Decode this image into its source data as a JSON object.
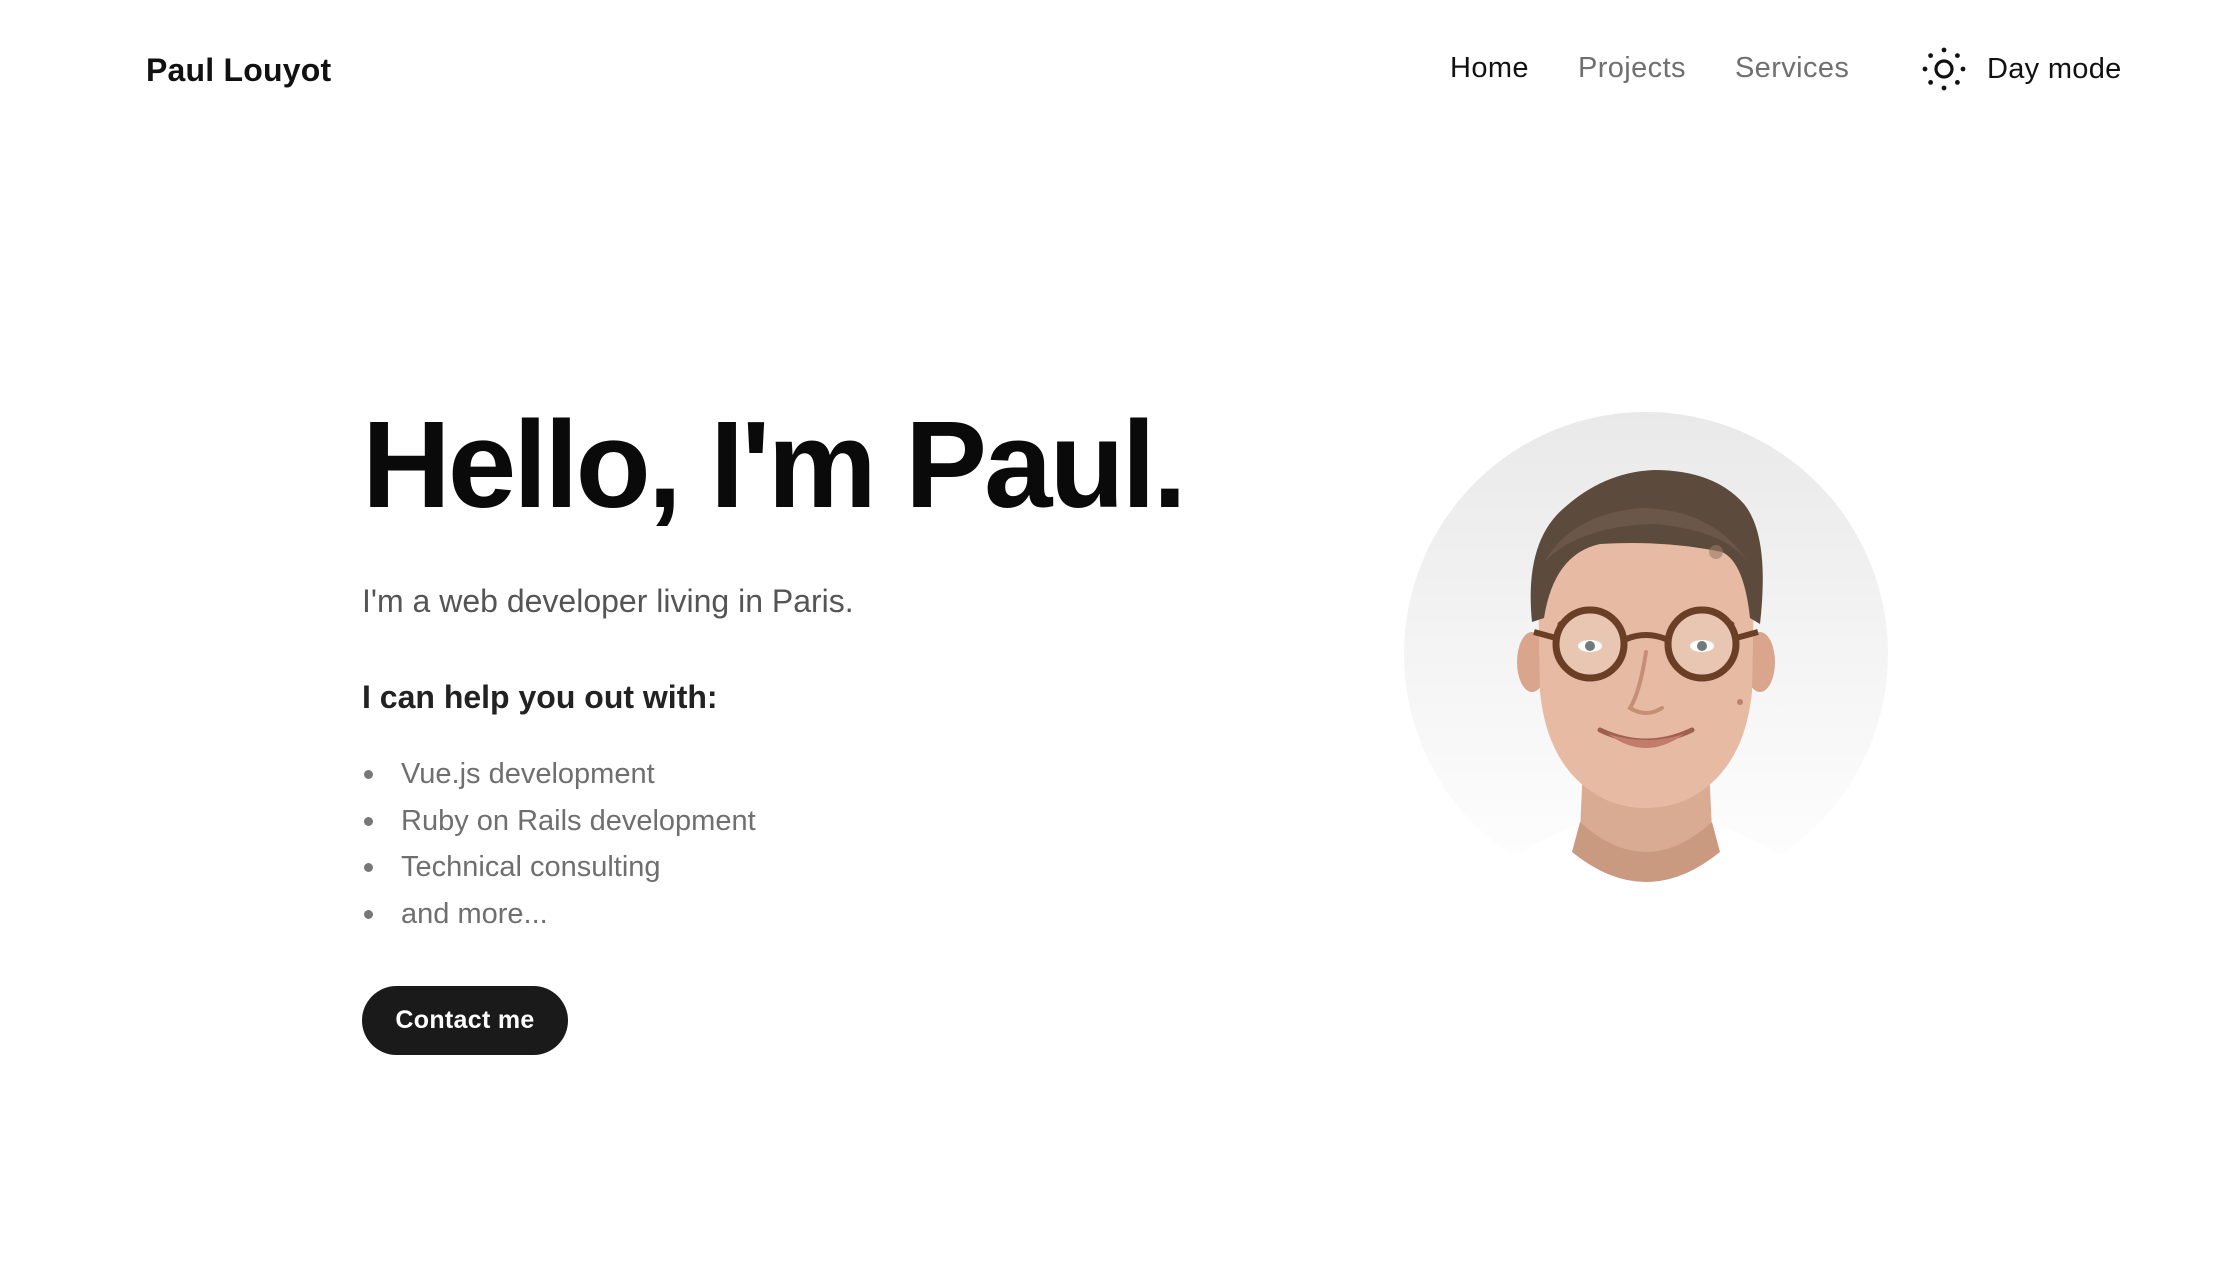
{
  "header": {
    "brand": "Paul Louyot",
    "nav": [
      {
        "label": "Home",
        "active": true
      },
      {
        "label": "Projects",
        "active": false
      },
      {
        "label": "Services",
        "active": false
      }
    ],
    "mode_toggle": {
      "label": "Day mode",
      "icon": "sun-icon"
    }
  },
  "hero": {
    "title": "Hello, I'm Paul.",
    "subtitle": "I'm a web developer living in Paris.",
    "help_heading": "I can help you out with:",
    "services": [
      "Vue.js development",
      "Ruby on Rails development",
      "Technical consulting",
      "and more..."
    ],
    "cta_label": "Contact me"
  },
  "colors": {
    "text_primary": "#111111",
    "text_muted": "#707070",
    "button_bg": "#1a1a1a",
    "button_text": "#ffffff"
  }
}
